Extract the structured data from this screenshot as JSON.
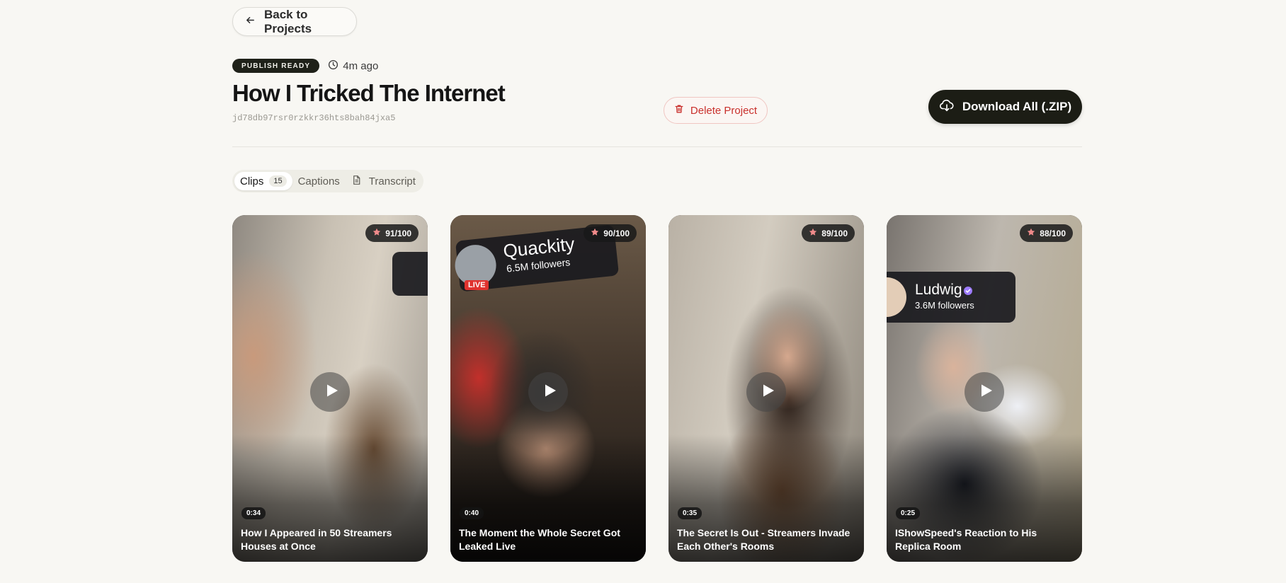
{
  "header": {
    "back_label": "Back to Projects",
    "status_badge": "PUBLISH READY",
    "time_ago": "4m ago",
    "title": "How I Tricked The Internet",
    "project_id": "jd78db97rsr0rzkkr36hts8bah84jxa5",
    "delete_label": "Delete Project",
    "download_label": "Download All (.ZIP)"
  },
  "tabs": [
    {
      "label": "Clips",
      "count": "15",
      "active": true
    },
    {
      "label": "Captions"
    },
    {
      "label": "Transcript",
      "icon": "document-icon"
    }
  ],
  "clips": [
    {
      "score": "91/100",
      "duration": "0:34",
      "title": "How I Appeared in 50 Streamers Houses at Once"
    },
    {
      "score": "90/100",
      "duration": "0:40",
      "title": "The Moment the Whole Secret Got Leaked Live",
      "overlay": {
        "name": "Quackity",
        "followers": "6.5M followers",
        "live": "LIVE"
      }
    },
    {
      "score": "89/100",
      "duration": "0:35",
      "title": "The Secret Is Out - Streamers Invade Each Other's Rooms"
    },
    {
      "score": "88/100",
      "duration": "0:25",
      "title": "IShowSpeed's Reaction to His Replica Room",
      "overlay": {
        "name": "Ludwig",
        "followers": "3.6M followers"
      }
    }
  ],
  "colors": {
    "background": "#f8f7f3",
    "primary_dark": "#1c1d15",
    "danger": "#c9302c",
    "star": "#f08a8a"
  }
}
